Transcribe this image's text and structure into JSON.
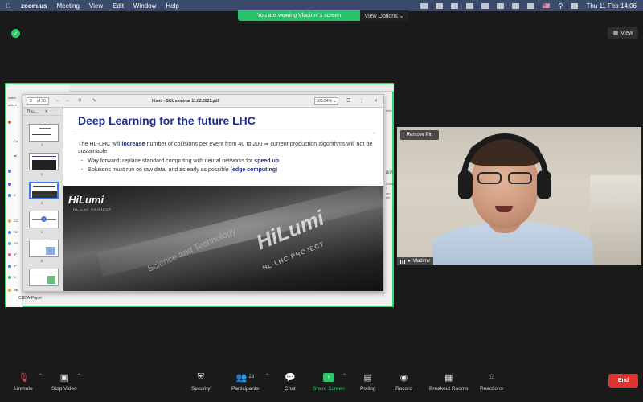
{
  "menubar": {
    "app": "zoom.us",
    "items": [
      "Meeting",
      "View",
      "Edit",
      "Window",
      "Help"
    ],
    "flag": "🇺🇸",
    "clock": "Thu 11 Feb 14:06"
  },
  "banner": {
    "message": "You are viewing Vladimir's screen",
    "options": "View Options ⌄"
  },
  "view_button": "View",
  "shared": {
    "left_labels": [
      "ccent",
      "ntitled f",
      "Ca",
      "ail",
      "C",
      "CC",
      "DN",
      "GA",
      "IP",
      "IP",
      "N",
      "Ne"
    ],
    "bottom_label": "CUDA-Paper",
    "right_labels": [
      "etch",
      "tions",
      "Zoom i",
      "am wh"
    ]
  },
  "pdf": {
    "title": "hlsml - SCL seminar 11.02.2021.pdf",
    "page_current": "3",
    "page_total": "of 30",
    "zoom": "105.54% ⌄",
    "thumb_header": "Thu...",
    "thumb_numbers": [
      "1",
      "2",
      "3",
      "4",
      "5",
      "6"
    ]
  },
  "slide": {
    "title": "Deep Learning for the future LHC",
    "bullet_pre": "The HL-LHC will ",
    "bullet_bold": "increase",
    "bullet_post": " number of collisions per event from 40 to 200 ⇒ current production algorithms will not be sustainable",
    "sub1_pre": "Way forward: replace standard computing with neural networks for ",
    "sub1_bold": "speed up",
    "sub2_pre": "Solutions must run on raw data, and as early as possible (",
    "sub2_bold": "edge computing",
    "sub2_post": ")",
    "logo_small": "HiLumi",
    "logo_small_sub": "HL-LHC PROJECT",
    "logo_big": "HiLumi",
    "logo_big_sub": "HL-LHC PROJECT",
    "photo_text": "Science and Technology"
  },
  "video": {
    "remove_pin": "Remove Pin",
    "name": "Vladimir"
  },
  "toolbar": {
    "unmute": "Unmute",
    "stop_video": "Stop Video",
    "security": "Security",
    "participants": "Participants",
    "participants_count": "23",
    "chat": "Chat",
    "share_screen": "Share Screen",
    "polling": "Polling",
    "record": "Record",
    "breakout": "Breakout Rooms",
    "reactions": "Reactions",
    "end": "End"
  },
  "colors": {
    "accent_green": "#2ec56b",
    "end_red": "#e0312e",
    "slide_title_blue": "#1e2a8f"
  }
}
